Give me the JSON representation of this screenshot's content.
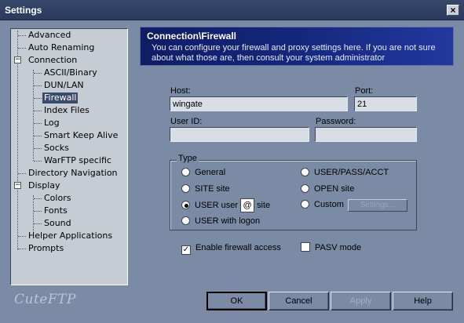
{
  "window": {
    "title": "Settings",
    "close_glyph": "×"
  },
  "tree": {
    "items": [
      {
        "label": "Advanced"
      },
      {
        "label": "Auto Renaming"
      },
      {
        "label": "Connection",
        "expander": "−"
      },
      {
        "label": "ASCII/Binary"
      },
      {
        "label": "DUN/LAN"
      },
      {
        "label": "Firewall",
        "selected": true
      },
      {
        "label": "Index Files"
      },
      {
        "label": "Log"
      },
      {
        "label": "Smart Keep Alive"
      },
      {
        "label": "Socks"
      },
      {
        "label": "WarFTP specific"
      },
      {
        "label": "Directory Navigation"
      },
      {
        "label": "Display",
        "expander": "−"
      },
      {
        "label": "Colors"
      },
      {
        "label": "Fonts"
      },
      {
        "label": "Sound"
      },
      {
        "label": "Helper Applications"
      },
      {
        "label": "Prompts"
      }
    ]
  },
  "logo": "CuteFTP",
  "header": {
    "title": "Connection\\Firewall",
    "description": "You can configure your firewall and proxy settings here. If you are not sure about what those are, then consult your system administrator"
  },
  "form": {
    "host_label": "Host:",
    "host_value": "wingate",
    "port_label": "Port:",
    "port_value": "21",
    "userid_label": "User ID:",
    "userid_value": "",
    "password_label": "Password:",
    "password_value": ""
  },
  "type_group": {
    "legend": "Type",
    "options_left": [
      {
        "label": "General",
        "checked": false
      },
      {
        "label": "SITE site",
        "checked": false
      },
      {
        "label_pre": "USER user",
        "at": "@",
        "label_post": "site",
        "checked": true
      },
      {
        "label": "USER with logon",
        "checked": false
      }
    ],
    "options_right": [
      {
        "label": "USER/PASS/ACCT",
        "checked": false
      },
      {
        "label": "OPEN site",
        "checked": false
      },
      {
        "label": "Custom",
        "checked": false
      }
    ],
    "settings_button": "Settings..."
  },
  "checkboxes": {
    "enable_firewall": {
      "label": "Enable firewall access",
      "checked": true,
      "mark": "✓"
    },
    "pasv_mode": {
      "label": "PASV mode",
      "checked": false
    }
  },
  "buttons": {
    "ok": "OK",
    "cancel": "Cancel",
    "apply": "Apply",
    "help": "Help"
  },
  "colors": {
    "background": "#7b8aa5",
    "header_bg": "#15277c",
    "tree_bg": "#c6ccd3",
    "selection": "#3a4a6a"
  }
}
